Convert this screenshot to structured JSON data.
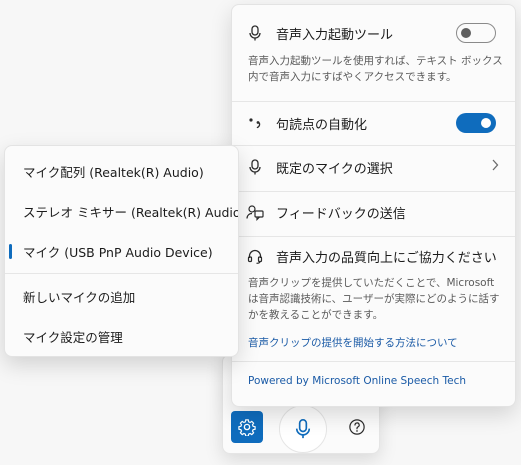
{
  "colors": {
    "accent": "#0f6cbd",
    "link": "#1a5aa6"
  },
  "toolbar": {
    "settings_icon": "gear-icon",
    "mic_icon": "microphone-icon",
    "help_icon": "help-icon"
  },
  "flyout": {
    "launcher": {
      "label": "音声入力起動ツール",
      "toggle_state": "off",
      "description": "音声入力起動ツールを使用すれば、テキスト ボックス内で音声入力にすばやくアクセスできます。"
    },
    "punctuation": {
      "label": "句読点の自動化",
      "toggle_state": "on"
    },
    "default_mic": {
      "label": "既定のマイクの選択"
    },
    "feedback": {
      "label": "フィードバックの送信"
    },
    "improve": {
      "label": "音声入力の品質向上にご協力ください",
      "description": "音声クリップを提供していただくことで、Microsoft は音声認識技術に、ユーザーが実際にどのように話すかを教えることができます。",
      "link": "音声クリップの提供を開始する方法について"
    },
    "powered_by": "Powered by Microsoft Online Speech Tech"
  },
  "menu": {
    "items": [
      {
        "label": "マイク配列 (Realtek(R) Audio)",
        "selected": false
      },
      {
        "label": "ステレオ ミキサー (Realtek(R) Audio)",
        "selected": false
      },
      {
        "label": "マイク (USB PnP Audio Device)",
        "selected": true
      }
    ],
    "actions": [
      {
        "label": "新しいマイクの追加"
      },
      {
        "label": "マイク設定の管理"
      }
    ]
  }
}
